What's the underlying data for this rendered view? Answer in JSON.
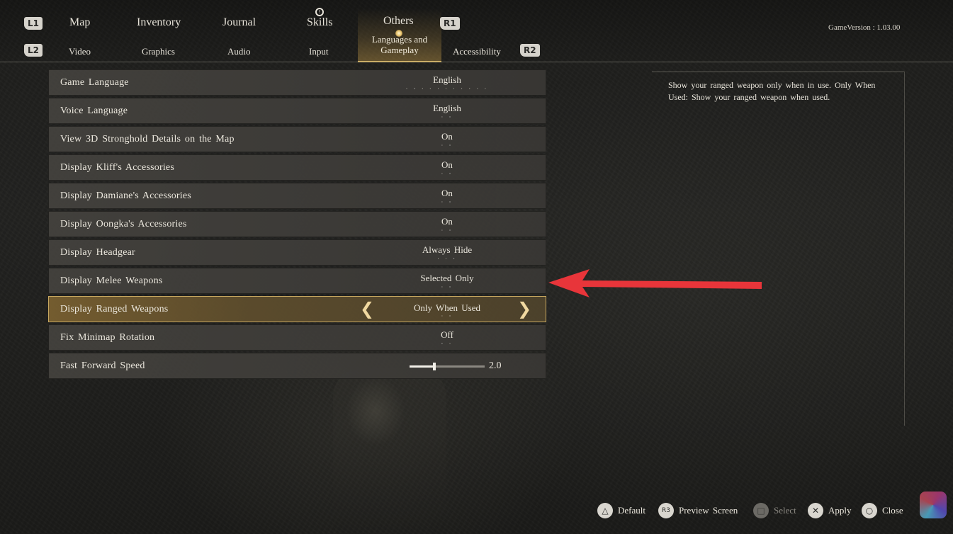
{
  "nav": {
    "l1": "L1",
    "r1": "R1",
    "l2": "L2",
    "r2": "R2",
    "tabs": [
      "Map",
      "Inventory",
      "Journal",
      "Skills",
      "Others"
    ],
    "active_tab": "Others",
    "subtabs": [
      "Video",
      "Graphics",
      "Audio",
      "Input",
      "Languages and Gameplay",
      "Accessibility"
    ],
    "active_subtab": "Languages and Gameplay"
  },
  "version": "GameVersion : 1.03.00",
  "settings": [
    {
      "label": "Game Language",
      "value": "English"
    },
    {
      "label": "Voice Language",
      "value": "English"
    },
    {
      "label": "View 3D Stronghold Details on the Map",
      "value": "On"
    },
    {
      "label": "Display Kliff's Accessories",
      "value": "On"
    },
    {
      "label": "Display Damiane's Accessories",
      "value": "On"
    },
    {
      "label": "Display Oongka's Accessories",
      "value": "On"
    },
    {
      "label": "Display Headgear",
      "value": "Always Hide"
    },
    {
      "label": "Display Melee Weapons",
      "value": "Selected Only"
    },
    {
      "label": "Display Ranged Weapons",
      "value": "Only When Used",
      "selected": true
    },
    {
      "label": "Fix Minimap Rotation",
      "value": "Off"
    },
    {
      "label": "Fast Forward Speed",
      "value": "2.0",
      "slider_fraction": 0.33
    }
  ],
  "description": "Show your ranged weapon only when in use. Only When Used: Show your ranged weapon when used.",
  "hints": [
    {
      "icon": "triangle-icon",
      "label": "Default"
    },
    {
      "icon": "r3-icon",
      "label": "Preview Screen"
    },
    {
      "icon": "square-icon",
      "label": "Select",
      "disabled": true
    },
    {
      "icon": "cross-icon",
      "label": "Apply"
    },
    {
      "icon": "circle-icon",
      "label": "Close"
    }
  ],
  "colors": {
    "accent_gold": "#c9a95c",
    "annotation_red": "#e8353a"
  }
}
